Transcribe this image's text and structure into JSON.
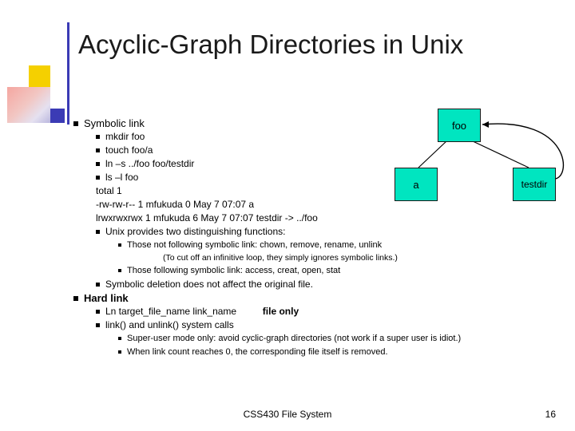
{
  "slide": {
    "title": "Acyclic-Graph Directories in Unix",
    "footer_title": "CSS430 File System",
    "page_number": "16"
  },
  "content": {
    "symbolic_link_heading": "Symbolic link",
    "commands": [
      "mkdir foo",
      "touch foo/a",
      "ln –s ../foo foo/testdir",
      "ls –l foo"
    ],
    "listing": [
      "total 1",
      "-rw-rw-r--      1 mfukuda 0 May 7 07:07 a",
      "lrwxrwxrwx   1 mfukuda 6 May 7 07:07 testdir -> ../foo"
    ],
    "unix_functions_heading": "Unix provides two distinguishing functions:",
    "unix_functions": [
      "Those not following symbolic link: chown, remove, rename, unlink",
      "Those following symbolic link: access, creat, open, stat"
    ],
    "loop_note": "(To cut off an infinitive loop, they simply ignores symbolic links.)",
    "symbolic_deletion": "Symbolic deletion does not affect the original file.",
    "hard_link_heading": "Hard link",
    "hard_link_items": [
      "Ln target_file_name link_name",
      "link() and unlink() system calls"
    ],
    "hard_link_tag": "file only",
    "hard_link_notes": [
      "Super-user mode only: avoid cyclic-graph directories (not work if a super user is idiot.)",
      "When link count reaches 0, the corresponding file itself is removed."
    ]
  },
  "diagram": {
    "nodes": {
      "foo": "foo",
      "a": "a",
      "testdir": "testdir"
    },
    "node_color": "#00e5c0",
    "line_color": "#000000"
  }
}
